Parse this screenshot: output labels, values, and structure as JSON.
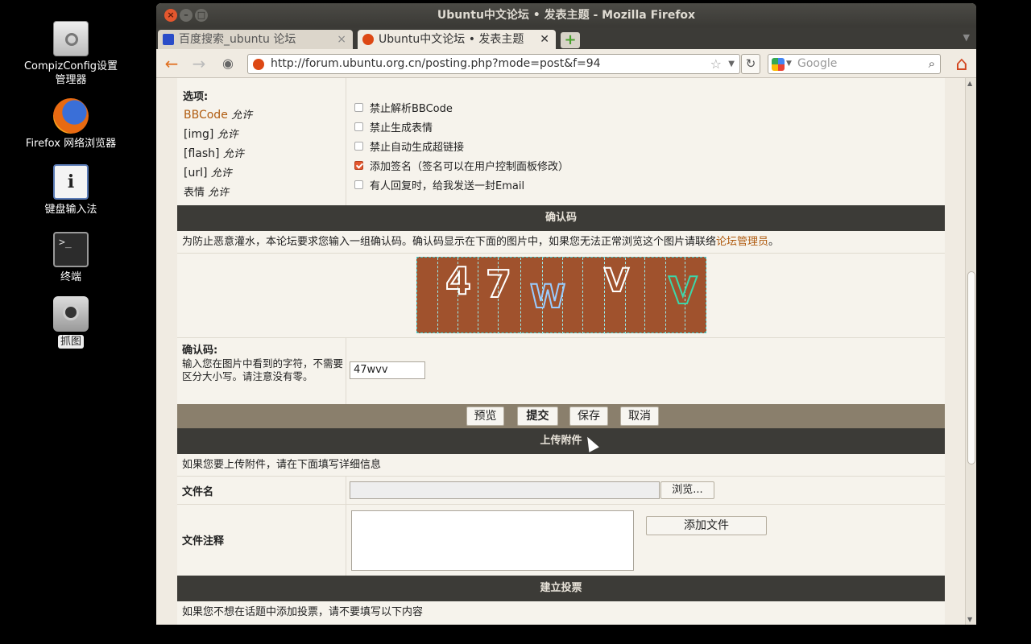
{
  "desktop": {
    "icons": [
      {
        "label": "CompizConfig设置\n管理器",
        "icon": "compizconfig-icon"
      },
      {
        "label": "Firefox 网络浏览器",
        "icon": "firefox-icon"
      },
      {
        "label": "键盘输入法",
        "icon": "keyboard-input-icon"
      },
      {
        "label": "终端",
        "icon": "terminal-icon"
      },
      {
        "label": "抓图",
        "icon": "screenshot-icon"
      }
    ]
  },
  "window": {
    "title": "Ubuntu中文论坛 • 发表主题 - Mozilla Firefox",
    "tabs": [
      {
        "label": "百度搜索_ubuntu 论坛"
      },
      {
        "label": "Ubuntu中文论坛 • 发表主题"
      }
    ],
    "url": "http://forum.ubuntu.org.cn/posting.php?mode=post&f=94",
    "search_placeholder": "Google"
  },
  "options": {
    "heading": "选项:",
    "perms": [
      {
        "name": "BBCode",
        "state": "允许",
        "link": true
      },
      {
        "name": "[img]",
        "state": "允许",
        "link": false
      },
      {
        "name": "[flash]",
        "state": "允许",
        "link": false
      },
      {
        "name": "[url]",
        "state": "允许",
        "link": false
      },
      {
        "name": "表情",
        "state": "允许",
        "link": false
      }
    ],
    "checkboxes": [
      {
        "label": "禁止解析BBCode",
        "checked": false
      },
      {
        "label": "禁止生成表情",
        "checked": false
      },
      {
        "label": "禁止自动生成超链接",
        "checked": false
      },
      {
        "label": "添加签名（签名可以在用户控制面板修改）",
        "checked": true
      },
      {
        "label": "有人回复时，给我发送一封Email",
        "checked": false
      }
    ]
  },
  "captcha": {
    "header": "确认码",
    "notice": "为防止恶意灌水，本论坛要求您输入一组确认码。确认码显示在下面的图片中，如果您无法正常浏览这个图片请联络",
    "notice_link": "论坛管理员",
    "notice_end": "。",
    "image_chars": [
      "4",
      "7",
      "W",
      "V",
      "V"
    ],
    "label": "确认码:",
    "hint": "输入您在图片中看到的字符，不需要区分大小写。请注意没有零。",
    "value": "47wvv"
  },
  "actions": {
    "preview": "预览",
    "submit": "提交",
    "save": "保存",
    "cancel": "取消"
  },
  "attachments": {
    "header": "上传附件",
    "notice": "如果您要上传附件，请在下面填写详细信息",
    "filename_label": "文件名",
    "browse": "浏览...",
    "comment_label": "文件注释",
    "add_file": "添加文件"
  },
  "poll": {
    "header": "建立投票",
    "notice": "如果您不想在话题中添加投票，请不要填写以下内容"
  }
}
